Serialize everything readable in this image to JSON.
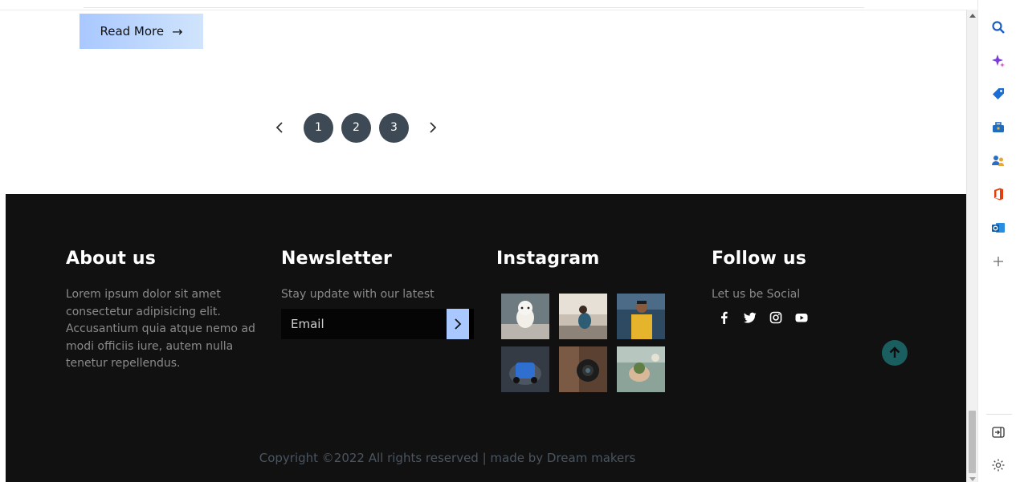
{
  "content": {
    "read_more_label": "Read More",
    "pagination": {
      "pages": [
        "1",
        "2",
        "3"
      ]
    }
  },
  "footer": {
    "about": {
      "title": "About us",
      "text": "Lorem ipsum dolor sit amet consectetur adipisicing elit. Accusantium quia atque nemo ad modi officiis iure, autem nulla tenetur repellendus."
    },
    "newsletter": {
      "title": "Newsletter",
      "text": "Stay update with our latest",
      "email_placeholder": "Email"
    },
    "instagram": {
      "title": "Instagram",
      "photos": [
        "white-dog-photo",
        "woman-by-window-photo",
        "man-in-yellow-shirt-photo",
        "blue-toy-car-photo",
        "camera-lens-photo",
        "hand-holding-plant-photo"
      ]
    },
    "follow": {
      "title": "Follow us",
      "text": "Let us be Social",
      "socials": [
        "facebook-icon",
        "twitter-icon",
        "instagram-icon",
        "youtube-icon"
      ]
    },
    "copyright": "Copyright ©2022 All rights reserved | made by Dream makers"
  },
  "colors": {
    "footer_bg": "#111111",
    "accent_blue": "#a9c8ff",
    "pagination_circle": "#3d4a56",
    "scroll_top": "#1a5e60"
  },
  "sidebar_icons": [
    "search-icon",
    "copilot-icon",
    "shopping-tag-icon",
    "tools-icon",
    "people-icon",
    "office-icon",
    "outlook-icon",
    "add-icon",
    "sidebar-toggle-icon",
    "settings-icon"
  ]
}
